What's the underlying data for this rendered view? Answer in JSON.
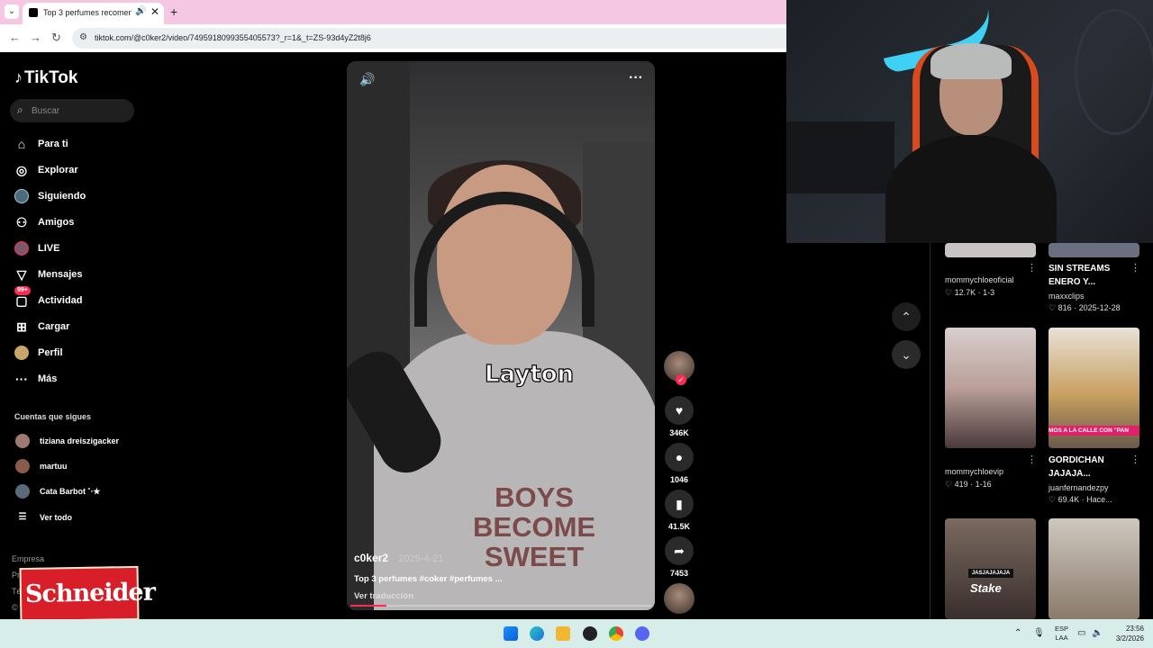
{
  "browser": {
    "tab_title": "Top 3 perfumes recomenda",
    "url": "tiktok.com/@c0ker2/video/7495918099355405573?_r=1&_t=ZS-93d4yZ2t8j6",
    "new_tab": "+",
    "tab_close": "✕"
  },
  "sidebar": {
    "logo": "TikTok",
    "search_placeholder": "Buscar",
    "menu": [
      {
        "label": "Para ti",
        "icon": "home-icon"
      },
      {
        "label": "Explorar",
        "icon": "compass-icon"
      },
      {
        "label": "Siguiendo",
        "icon": "following-avatar-icon"
      },
      {
        "label": "Amigos",
        "icon": "friends-icon"
      },
      {
        "label": "LIVE",
        "icon": "live-avatar-icon"
      },
      {
        "label": "Mensajes",
        "icon": "send-icon"
      },
      {
        "label": "Actividad",
        "icon": "activity-icon",
        "badge": "99+"
      },
      {
        "label": "Cargar",
        "icon": "upload-icon"
      },
      {
        "label": "Perfil",
        "icon": "profile-avatar-icon"
      },
      {
        "label": "Más",
        "icon": "more-icon"
      }
    ],
    "following_title": "Cuentas que sigues",
    "following": [
      {
        "name": "tiziana dreiszigacker"
      },
      {
        "name": "martuu"
      },
      {
        "name": "Cata Barbot ˚‧★"
      }
    ],
    "see_all": "Ver todo",
    "footer": [
      "Empresa",
      "Programa",
      "Té",
      "©"
    ],
    "ad_text": "Schneider"
  },
  "video": {
    "overlay_word": "Layton",
    "shirt_text": "BOYS\nBECOME\nSWEET",
    "author": "c0ker2",
    "date": "· 2025-4-21",
    "description": "Top 3 perfumes #coker #perfumes ...",
    "translate": "Ver traducción",
    "progress": 0.12
  },
  "actions": {
    "likes": "346K",
    "comments": "1046",
    "saves": "41.5K",
    "shares": "7453"
  },
  "thumbnails": [
    {
      "user": "mommychloeoficial",
      "likes": "12.7K",
      "meta": "1-3"
    },
    {
      "title": "SIN STREAMS ENERO Y...",
      "user": "maxxclips",
      "likes": "816",
      "meta": "2025-12-28"
    },
    {
      "user": "mommychloevip",
      "likes": "419",
      "meta": "1-16"
    },
    {
      "title": "GORDICHAN JAJAJA...",
      "user": "juanfernandezpy",
      "likes": "69.4K",
      "meta": "Hace...",
      "banner": "MOS A LA CALLE CON \"PAN"
    },
    {
      "banner": "JASJAJAJAJA",
      "logo": "Stake"
    },
    {}
  ],
  "taskbar": {
    "lang_top": "ESP",
    "lang_bottom": "LAA",
    "time": "23:56",
    "date": "3/2/2026"
  },
  "colors": {
    "tiktok_red": "#fe2c55",
    "tab_bar": "#f5c7e3",
    "taskbar": "#d6ede9"
  }
}
